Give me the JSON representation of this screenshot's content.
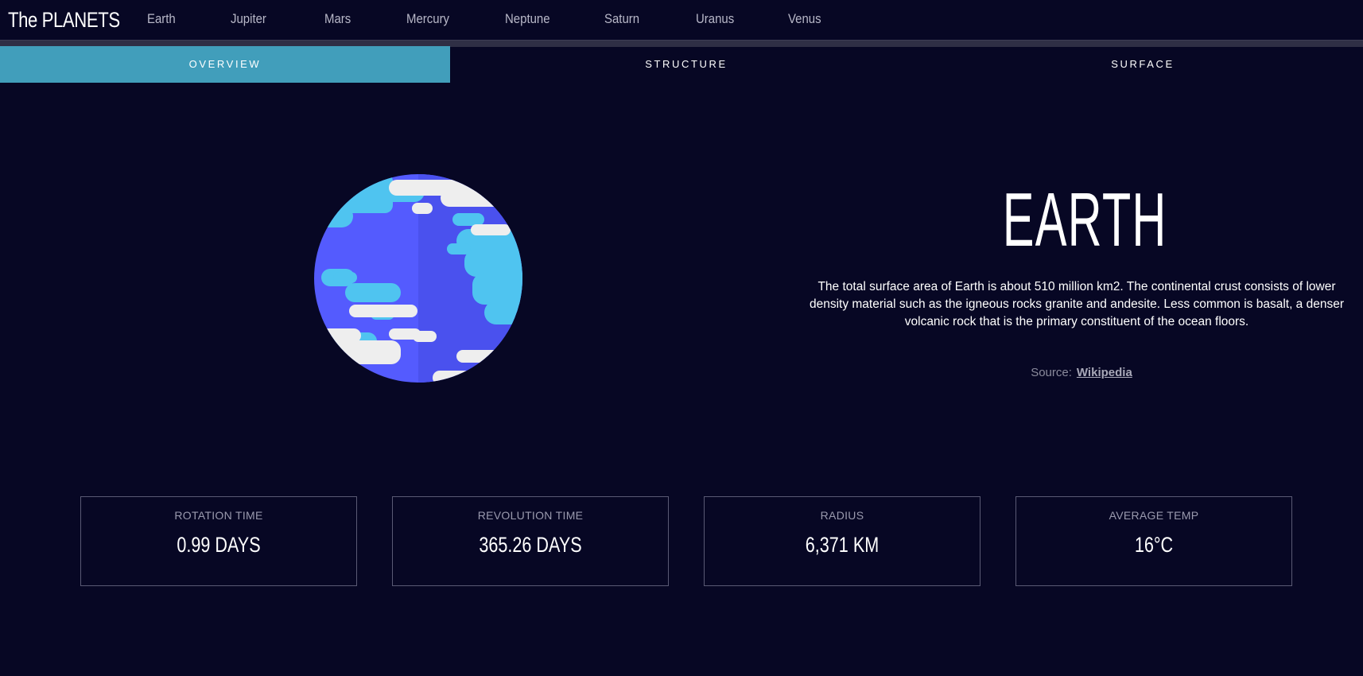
{
  "header": {
    "logo": "The PLANETS",
    "nav": [
      "Earth",
      "Jupiter",
      "Mars",
      "Mercury",
      "Neptune",
      "Saturn",
      "Uranus",
      "Venus"
    ]
  },
  "tabs": [
    {
      "label": "OVERVIEW",
      "active": true
    },
    {
      "label": "STRUCTURE",
      "active": false
    },
    {
      "label": "SURFACE",
      "active": false
    }
  ],
  "planet": {
    "name": "EARTH",
    "description": "The total surface area of Earth is about 510 million km2. The continental crust consists of lower density material such as the igneous rocks granite and andesite. Less common is basalt, a denser volcanic rock that is the primary constituent of the ocean floors.",
    "source_label": "Source:",
    "source_link": "Wikipedia",
    "image_icon": "earth-planet-illustration"
  },
  "stats": [
    {
      "label": "ROTATION TIME",
      "value": "0.99 DAYS"
    },
    {
      "label": "REVOLUTION TIME",
      "value": "365.26 DAYS"
    },
    {
      "label": "RADIUS",
      "value": "6,371 KM"
    },
    {
      "label": "AVERAGE TEMP",
      "value": "16°C"
    }
  ],
  "colors": {
    "background": "#070724",
    "accent": "#419ebb",
    "planet_blue": "#545bfe",
    "planet_cyan": "#4fc4f0",
    "planet_white": "#eeeeee"
  }
}
